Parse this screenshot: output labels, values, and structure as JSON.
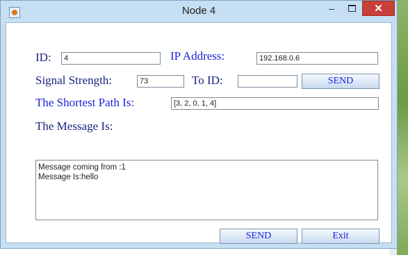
{
  "window": {
    "title": "Node 4",
    "minimize_glyph": "–",
    "close_glyph": "✕"
  },
  "form": {
    "id_label": "ID:",
    "id_value": "4",
    "ip_label": "IP Address:",
    "ip_value": "192.168.0.6",
    "signal_label": "Signal Strength:",
    "signal_value": "73",
    "to_id_label": "To ID:",
    "to_id_value": "",
    "send_top_label": "SEND",
    "shortest_path_label": "The Shortest Path Is:",
    "shortest_path_value": "[3, 2, 0, 1, 4]",
    "message_label": "The Message Is:",
    "messages": [
      "Message coming from :1",
      "Message Is:hello"
    ]
  },
  "footer": {
    "send_label": "SEND",
    "exit_label": "Exit"
  },
  "colors": {
    "label_text": "#1a237e",
    "accent_text": "#1a23d6",
    "window_frame": "#c7dff2",
    "close_button": "#c9403a"
  },
  "icons": {
    "app": "java-cup-icon",
    "minimize": "minimize-icon",
    "maximize": "maximize-icon",
    "close": "close-icon"
  }
}
